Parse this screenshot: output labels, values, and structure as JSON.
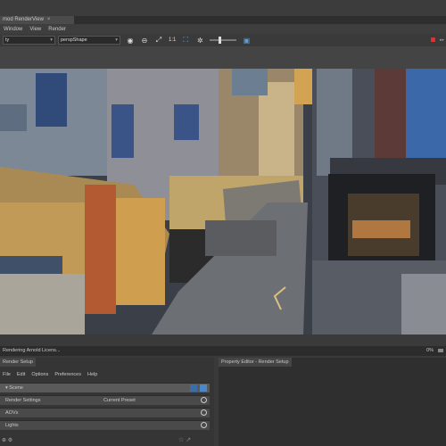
{
  "app": {
    "window_title": "mod RenderView"
  },
  "menu": [
    "Window",
    "View",
    "Render"
  ],
  "toolbar": {
    "layer_select": "ty",
    "camera_select": "perspShape",
    "ratio_label": "1:1"
  },
  "status": {
    "left_text": "Rendering Arnold Licens...",
    "right_text": "0%"
  },
  "render_setup": {
    "title": "Render Setup",
    "menu": [
      "File",
      "Edit",
      "Options",
      "Preferences",
      "Help"
    ],
    "rows": [
      {
        "label": "Scene",
        "value": ""
      },
      {
        "label": "Render Settings",
        "value": "Current Preset"
      },
      {
        "label": "AOVs",
        "value": ""
      },
      {
        "label": "Lights",
        "value": ""
      }
    ]
  },
  "property_editor": {
    "title": "Property Editor - Render Setup"
  },
  "colors": {
    "accent": "#3a6ea8",
    "stop": "#e03030"
  }
}
